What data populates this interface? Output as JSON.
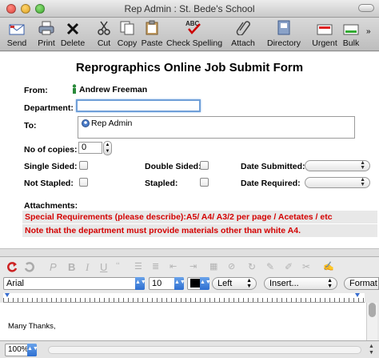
{
  "window": {
    "title": "Rep Admin : St. Bede's School"
  },
  "toolbar": {
    "send": "Send",
    "print": "Print",
    "delete": "Delete",
    "cut": "Cut",
    "copy": "Copy",
    "paste": "Paste",
    "check_spelling": "Check Spelling",
    "attach": "Attach",
    "directory": "Directory",
    "urgent": "Urgent",
    "bulk": "Bulk"
  },
  "form": {
    "title": "Reprographics Online Job Submit Form",
    "from_label": "From:",
    "from_value": "Andrew Freeman",
    "department_label": "Department:",
    "department_value": "",
    "to_label": "To:",
    "to_value": "Rep Admin",
    "copies_label": "No of copies:",
    "copies_value": "0",
    "single_sided_label": "Single Sided:",
    "double_sided_label": "Double Sided:",
    "date_submitted_label": "Date Submitted:",
    "not_stapled_label": "Not Stapled:",
    "stapled_label": "Stapled:",
    "date_required_label": "Date Required:",
    "attachments_label": "Attachments:",
    "special_requirements": "Special Requirements (please describe):A5/ A4/ A3/2 per page / Acetates / etc",
    "department_note": "Note that the department must provide materials other than white A4."
  },
  "editor": {
    "font": "Arial",
    "size": "10",
    "align": "Left",
    "insert": "Insert...",
    "format": "Format",
    "body_text": "Many Thanks,",
    "zoom": "100%"
  },
  "colors": {
    "note_red": "#d40000",
    "focus_blue": "#6f9fd8"
  }
}
